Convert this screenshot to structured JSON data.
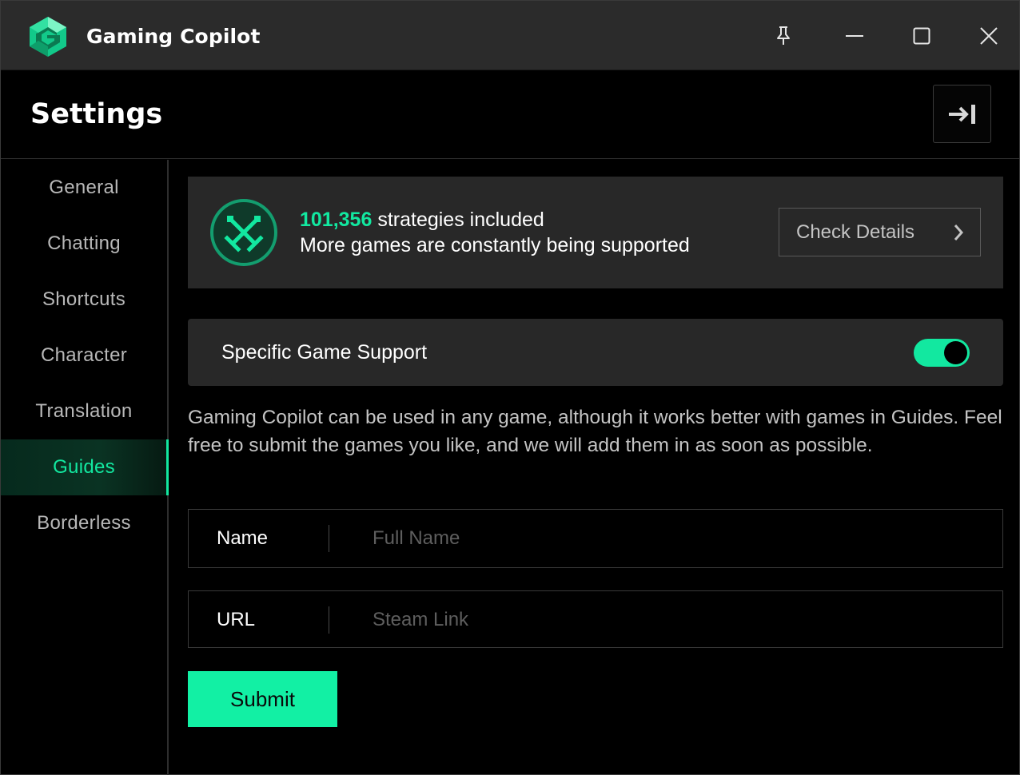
{
  "app": {
    "title": "Gaming Copilot",
    "logo_icon": "gaming-copilot-logo-icon",
    "accent_color": "#12e8a0"
  },
  "window_controls": {
    "pin_icon": "pin-icon",
    "minimize_icon": "minimize-icon",
    "maximize_icon": "maximize-icon",
    "close_icon": "close-icon"
  },
  "header": {
    "title": "Settings",
    "collapse_icon": "collapse-panel-icon"
  },
  "sidebar": {
    "items": [
      {
        "label": "General",
        "active": false
      },
      {
        "label": "Chatting",
        "active": false
      },
      {
        "label": "Shortcuts",
        "active": false
      },
      {
        "label": "Character",
        "active": false
      },
      {
        "label": "Translation",
        "active": false
      },
      {
        "label": "Guides",
        "active": true
      },
      {
        "label": "Borderless",
        "active": false
      }
    ]
  },
  "banner": {
    "icon": "crossed-swords-icon",
    "count": "101,356",
    "count_suffix": " strategies included",
    "subtitle": "More games are constantly being supported",
    "button_label": "Check Details",
    "button_icon": "chevron-right-icon"
  },
  "game_support": {
    "label": "Specific Game Support",
    "enabled": true
  },
  "description": "Gaming Copilot can be used in any game, although it works better with games in Guides. Feel free to submit the games you like, and we will add them in as soon as possible.",
  "form": {
    "name_label": "Name",
    "name_placeholder": "Full Name",
    "name_value": "",
    "url_label": "URL",
    "url_placeholder": "Steam Link",
    "url_value": "",
    "submit_label": "Submit"
  }
}
